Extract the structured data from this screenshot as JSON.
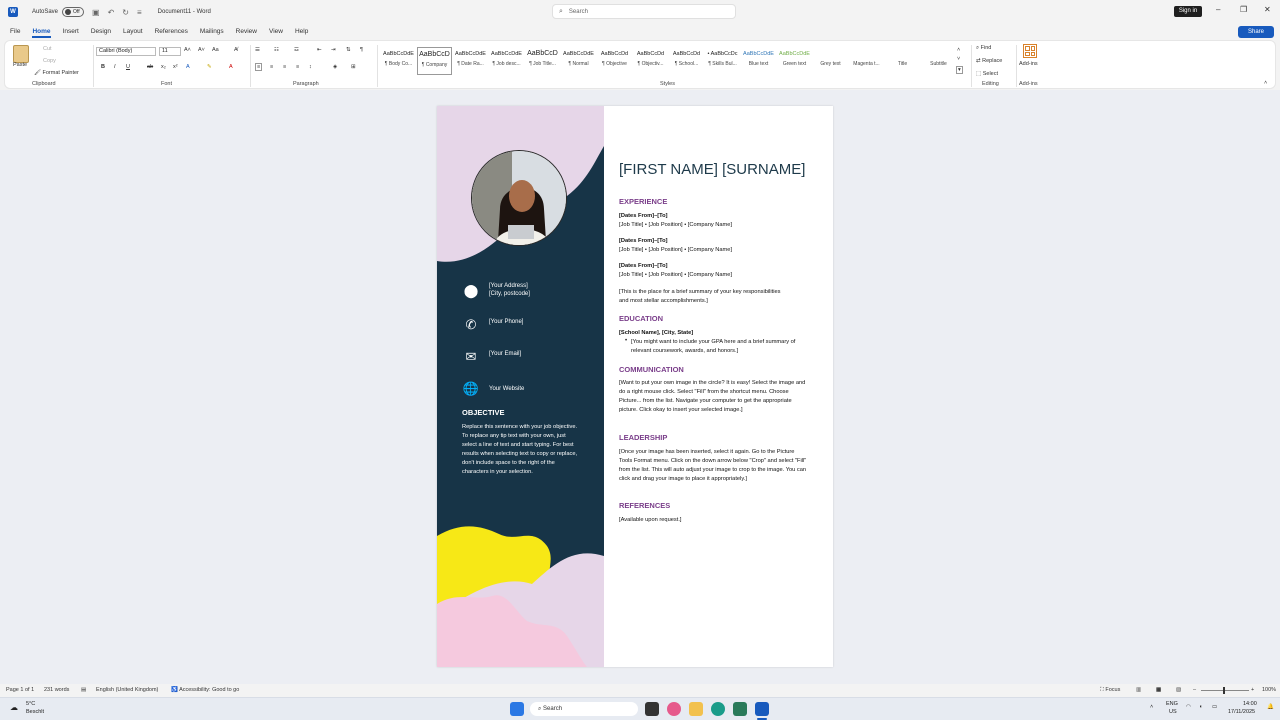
{
  "app": {
    "autosave_label": "AutoSave",
    "autosave_state": "Off",
    "doc_title": "Document11 - Word",
    "search_placeholder": "Search",
    "signin": "Sign in",
    "share": "Share"
  },
  "menu": [
    "File",
    "Home",
    "Insert",
    "Design",
    "Layout",
    "References",
    "Mailings",
    "Review",
    "View",
    "Help"
  ],
  "ribbon": {
    "clipboard": {
      "paste": "Paste",
      "cut": "Cut",
      "copy": "Copy",
      "format_painter": "Format Painter",
      "label": "Clipboard"
    },
    "font": {
      "name": "Calibri (Body)",
      "size": "11",
      "label": "Font"
    },
    "paragraph": {
      "label": "Paragraph"
    },
    "styles": {
      "label": "Styles",
      "items": [
        {
          "preview": "AaBbCcDdE",
          "name": "¶ Body Co..."
        },
        {
          "preview": "AaBbCcD",
          "name": "¶ Company"
        },
        {
          "preview": "AaBbCcDdE",
          "name": "¶ Date Ra..."
        },
        {
          "preview": "AaBbCcDdE",
          "name": "¶ Job desc..."
        },
        {
          "preview": "AaBbCcD",
          "name": "¶ Job Title..."
        },
        {
          "preview": "AaBbCcDdE",
          "name": "¶ Normal"
        },
        {
          "preview": "AaBbCcDd",
          "name": "¶ Objective"
        },
        {
          "preview": "AaBbCcDd",
          "name": "¶ Objectiv..."
        },
        {
          "preview": "AaBbCcDd",
          "name": "¶ School..."
        },
        {
          "preview": "• AaBbCcDc",
          "name": "¶ Skills Bul..."
        },
        {
          "preview": "AaBbCcDdE",
          "name": "Blue text"
        },
        {
          "preview": "AaBbCcDdE",
          "name": "Green text"
        },
        {
          "preview": "",
          "name": "Grey text"
        },
        {
          "preview": "",
          "name": "Magenta t..."
        },
        {
          "preview": "",
          "name": "Title"
        },
        {
          "preview": "",
          "name": "Subtitle"
        }
      ]
    },
    "editing": {
      "find": "Find",
      "replace": "Replace",
      "select": "Select",
      "label": "Editing"
    },
    "addins": {
      "button": "Add-ins",
      "label": "Add-ins"
    }
  },
  "resume": {
    "name": "[FIRST NAME] [SURNAME]",
    "contact": {
      "address1": "[Your Address]",
      "address2": "[City, postcode]",
      "phone": "[Your Phone]",
      "email": "[Your Email]",
      "website": "Your Website"
    },
    "objective_head": "OBJECTIVE",
    "objective_body": "Replace this sentence with your job objective. To replace any tip text with your own, just select a line of text and start typing. For best results when selecting text to copy or replace, don't include space to the right of the characters in your selection.",
    "experience_head": "EXPERIENCE",
    "experience": [
      {
        "dates": "[Dates From]–[To]",
        "line": "[Job Title] • [Job Position] • [Company Name]"
      },
      {
        "dates": "[Dates From]–[To]",
        "line": "[Job Title] • [Job Position] • [Company Name]"
      },
      {
        "dates": "[Dates From]–[To]",
        "line": "[Job Title] • [Job Position] • [Company Name]"
      }
    ],
    "experience_summary": "[This is the place for a brief summary of your key responsibilities and most stellar accomplishments.]",
    "education_head": "EDUCATION",
    "school": "[School Name], [City, State]",
    "education_bullet": "[You might want to include your GPA here and a brief summary of relevant coursework, awards, and honors.]",
    "communication_head": "COMMUNICATION",
    "communication_body": "[Want to put your own image in the circle? It is easy! Select the image and do a right mouse click. Select \"Fill\" from the shortcut menu. Choose Picture... from the list. Navigate your computer to get the appropriate picture. Click okay to insert your selected image.]",
    "leadership_head": "LEADERSHIP",
    "leadership_body": "[Once your image has been inserted, select it again. Go to the Picture Tools Format menu. Click on the down arrow below \"Crop\" and select \"Fill\" from the list. This will auto adjust your image to crop to the image. You can click and drag your image to place it appropriately.]",
    "references_head": "REFERENCES",
    "references_body": "[Available upon request.]"
  },
  "status": {
    "page": "Page 1 of 1",
    "words": "231 words",
    "language": "English (United Kingdom)",
    "accessibility": "Accessibility: Good to go",
    "focus": "Focus",
    "zoom": "100%"
  },
  "taskbar": {
    "weather_temp": "5°C",
    "weather_desc": "Beschlt",
    "search": "Search",
    "lang1": "ENG",
    "lang2": "US",
    "time": "14:00",
    "date": "17/11/2025"
  },
  "colors": {
    "word_blue": "#185abd",
    "resume_dark": "#173447",
    "resume_lilac": "#e6d6e8",
    "resume_yellow": "#f7e816",
    "resume_pink": "#f5c9de",
    "heading_purple": "#7a3e8a"
  }
}
